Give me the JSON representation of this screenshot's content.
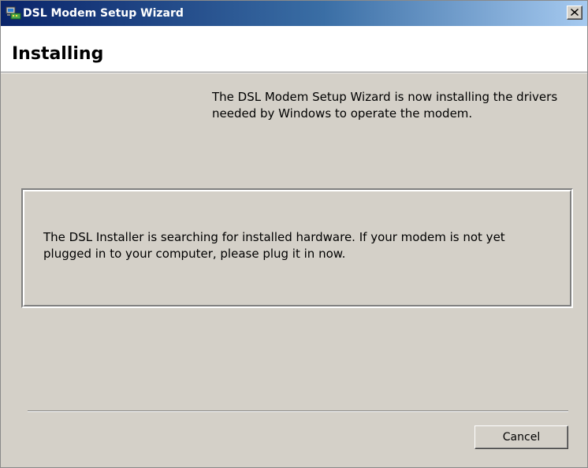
{
  "window": {
    "title": "DSL Modem Setup Wizard",
    "icon": "modem-computer-icon",
    "close_icon": "close-icon"
  },
  "header": {
    "title": "Installing"
  },
  "main": {
    "intro_text": "The DSL Modem Setup Wizard is now installing the drivers needed by Windows to operate the modem.",
    "status_text": "The DSL Installer is searching for installed hardware.  If your modem is not yet plugged in to your computer, please plug it in now."
  },
  "footer": {
    "cancel_label": "Cancel"
  },
  "colors": {
    "titlebar_start": "#0a246a",
    "titlebar_end": "#a6caf0",
    "dialog_background": "#d4d0c8",
    "header_background": "#ffffff"
  }
}
